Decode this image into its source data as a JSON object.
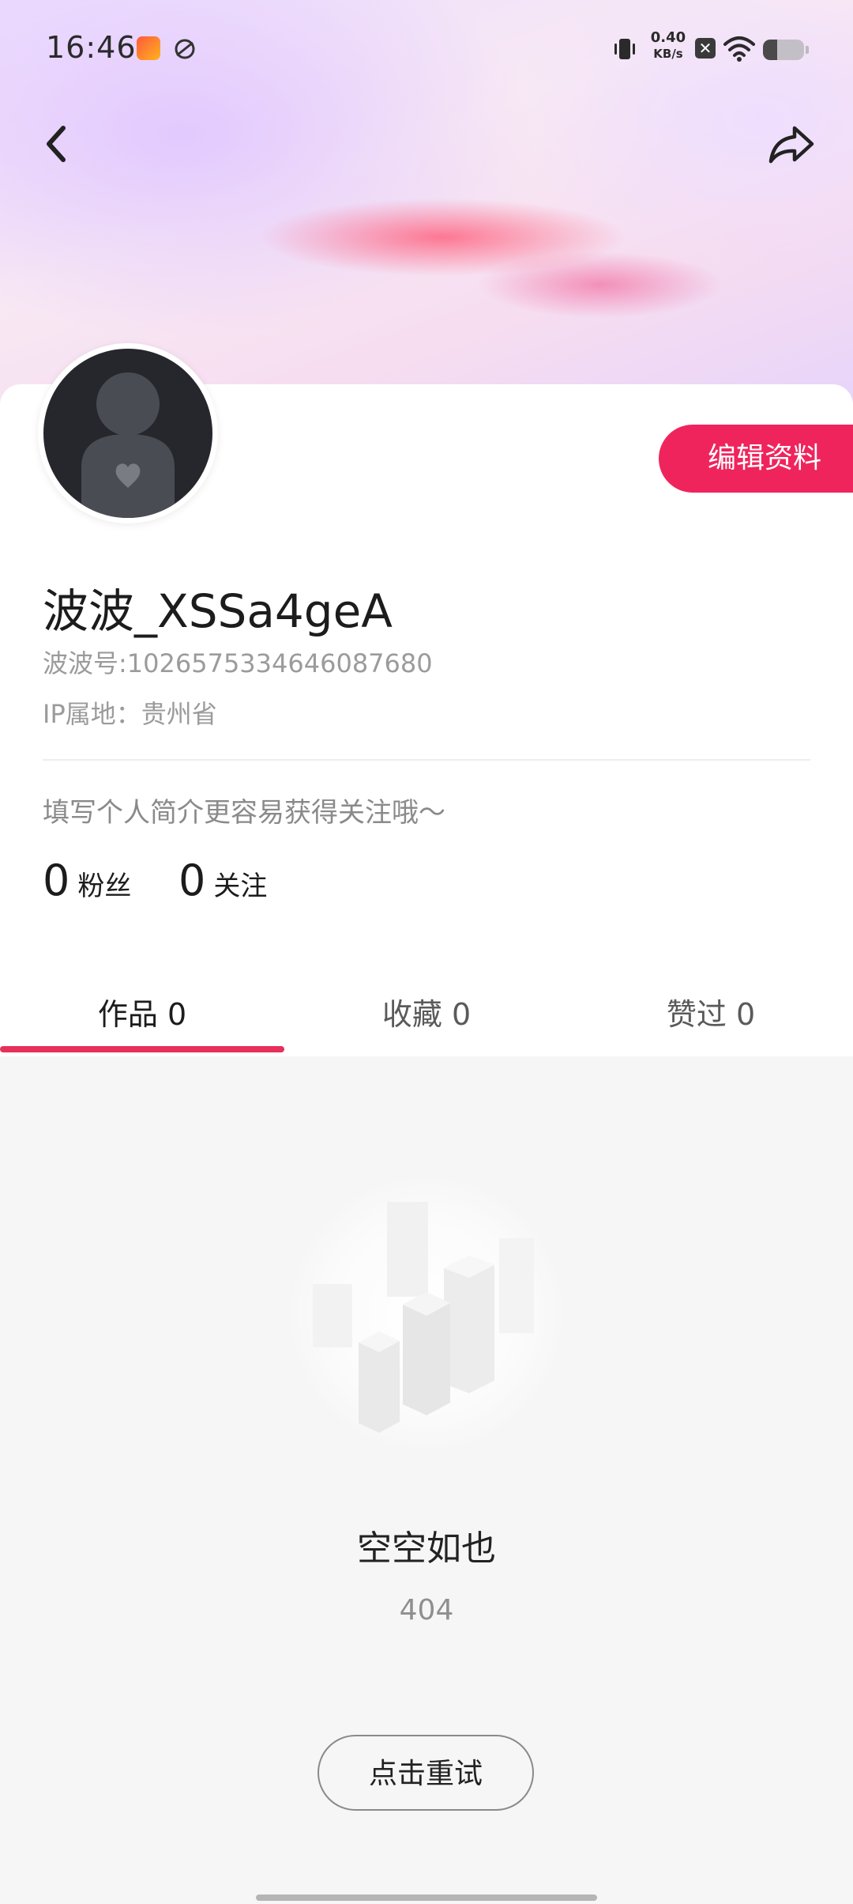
{
  "status_bar": {
    "time": "16:46",
    "net_speed": "0.40",
    "net_unit": "KB/s",
    "sim_label": "✕",
    "battery_level": 0.35
  },
  "profile": {
    "edit_button": "编辑资料",
    "username": "波波_XSSa4geA",
    "user_id": "波波号:1026575334646087680",
    "ip_location": "IP属地：贵州省",
    "bio_placeholder": "填写个人简介更容易获得关注哦～",
    "stats": [
      {
        "count": "0",
        "label": "粉丝"
      },
      {
        "count": "0",
        "label": "关注"
      }
    ]
  },
  "tabs": [
    {
      "label": "作品 0",
      "active": true
    },
    {
      "label": "收藏 0",
      "active": false
    },
    {
      "label": "赞过 0",
      "active": false
    }
  ],
  "empty_state": {
    "title": "空空如也",
    "code": "404",
    "retry_button": "点击重试"
  },
  "colors": {
    "accent": "#f0245c",
    "tab_indicator": "#e6305b"
  }
}
